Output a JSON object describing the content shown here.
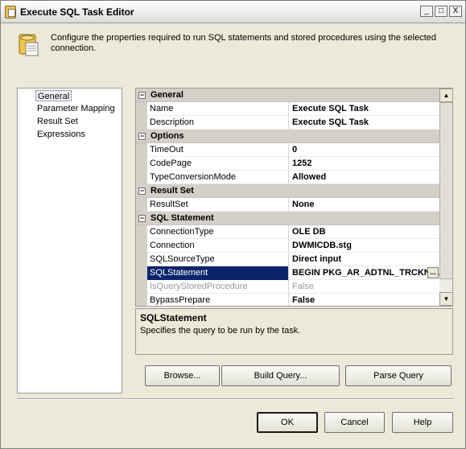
{
  "window": {
    "title": "Execute SQL Task Editor",
    "controls": [
      "_",
      "□",
      "X"
    ]
  },
  "header": {
    "icon": "database-task-icon",
    "description": "Configure the properties required to run SQL statements and stored procedures using the selected connection."
  },
  "nav": {
    "items": [
      {
        "label": "General",
        "selected": true
      },
      {
        "label": "Parameter Mapping",
        "selected": false
      },
      {
        "label": "Result Set",
        "selected": false
      },
      {
        "label": "Expressions",
        "selected": false
      }
    ]
  },
  "grid": {
    "categories": [
      {
        "name": "General",
        "props": [
          {
            "name": "Name",
            "value": "Execute SQL Task"
          },
          {
            "name": "Description",
            "value": "Execute SQL Task"
          }
        ]
      },
      {
        "name": "Options",
        "props": [
          {
            "name": "TimeOut",
            "value": "0"
          },
          {
            "name": "CodePage",
            "value": "1252"
          },
          {
            "name": "TypeConversionMode",
            "value": "Allowed"
          }
        ]
      },
      {
        "name": "Result Set",
        "props": [
          {
            "name": "ResultSet",
            "value": "None"
          }
        ]
      },
      {
        "name": "SQL Statement",
        "props": [
          {
            "name": "ConnectionType",
            "value": "OLE DB"
          },
          {
            "name": "Connection",
            "value": "DWMICDB.stg"
          },
          {
            "name": "SQLSourceType",
            "value": "Direct input"
          },
          {
            "name": "SQLStatement",
            "value": "BEGIN  PKG_AR_ADTNL_TRCKNG.",
            "selected": true,
            "ellipsis": "..."
          },
          {
            "name": "IsQueryStoredProcedure",
            "value": "False",
            "disabled": true
          },
          {
            "name": "BypassPrepare",
            "value": "False"
          }
        ]
      }
    ],
    "expander_glyph": "−"
  },
  "description": {
    "title": "SQLStatement",
    "text": "Specifies the query to be run by the task."
  },
  "actions": {
    "browse": "Browse...",
    "build_query": "Build Query...",
    "parse_query": "Parse Query"
  },
  "footer": {
    "ok": "OK",
    "cancel": "Cancel",
    "help": "Help"
  },
  "scrollbar": {
    "up": "▲",
    "down": "▼"
  }
}
